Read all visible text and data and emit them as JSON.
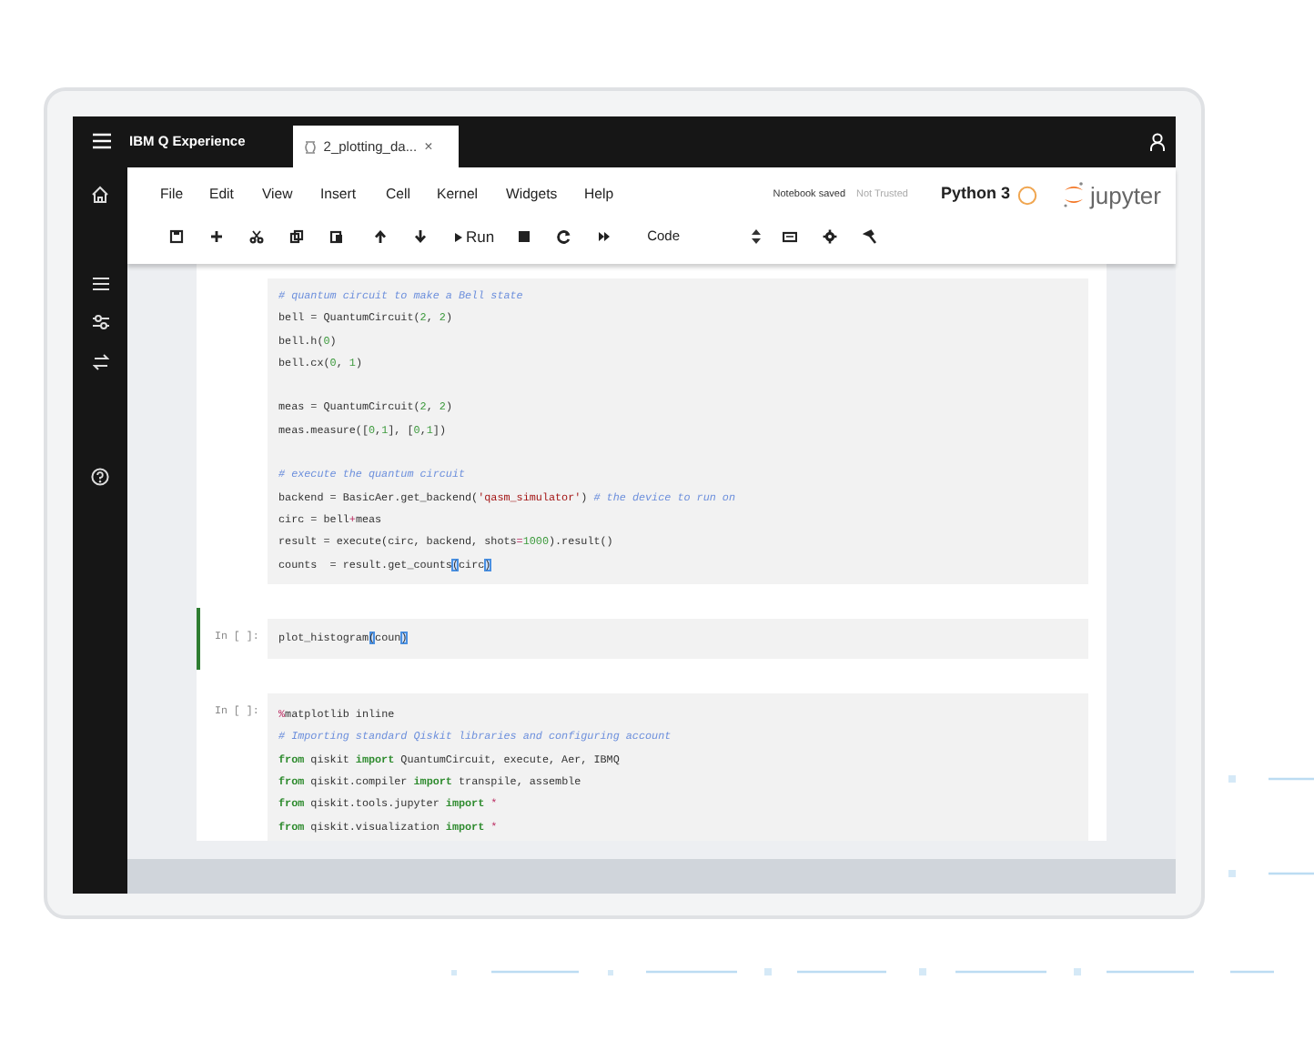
{
  "app_bar": {
    "title": "IBM Q Experience"
  },
  "tabs": [
    {
      "label": "2_plotting_da...",
      "close": "×",
      "selected": true
    }
  ],
  "menu": [
    "File",
    "Edit",
    "View",
    "Insert",
    "Cell",
    "Kernel",
    "Widgets",
    "Help"
  ],
  "status": {
    "save_state": "Notebook saved",
    "trust": "Not Trusted",
    "kernel": "Python 3",
    "kernel_busy": false,
    "logo": "jupyter"
  },
  "toolbar": {
    "run_label": "Run",
    "cell_type": "Code"
  },
  "cells": [
    {
      "selected": false,
      "lines": [
        {
          "kind": "code",
          "tokens": [
            {
              "kind": "comment",
              "text": "# quantum circuit to make a Bell state"
            }
          ]
        },
        {
          "kind": "code",
          "tokens": [
            {
              "kind": "plain",
              "text": "bell = QuantumCircuit("
            },
            {
              "kind": "num",
              "text": "2"
            },
            {
              "kind": "plain",
              "text": ", "
            },
            {
              "kind": "num",
              "text": "2"
            },
            {
              "kind": "plain",
              "text": ")"
            }
          ]
        },
        {
          "kind": "code",
          "tokens": [
            {
              "kind": "plain",
              "text": "bell.h("
            },
            {
              "kind": "num",
              "text": "0"
            },
            {
              "kind": "plain",
              "text": ")"
            }
          ]
        },
        {
          "kind": "code",
          "tokens": [
            {
              "kind": "plain",
              "text": "bell.cx("
            },
            {
              "kind": "num",
              "text": "0"
            },
            {
              "kind": "plain",
              "text": ", "
            },
            {
              "kind": "num",
              "text": "1"
            },
            {
              "kind": "plain",
              "text": ")"
            }
          ]
        },
        {
          "kind": "blank"
        },
        {
          "kind": "code",
          "tokens": [
            {
              "kind": "plain",
              "text": "meas = QuantumCircuit("
            },
            {
              "kind": "num",
              "text": "2"
            },
            {
              "kind": "plain",
              "text": ", "
            },
            {
              "kind": "num",
              "text": "2"
            },
            {
              "kind": "plain",
              "text": ")"
            }
          ]
        },
        {
          "kind": "code",
          "tokens": [
            {
              "kind": "plain",
              "text": "meas.measure(["
            },
            {
              "kind": "num",
              "text": "0"
            },
            {
              "kind": "plain",
              "text": ","
            },
            {
              "kind": "num",
              "text": "1"
            },
            {
              "kind": "plain",
              "text": "], ["
            },
            {
              "kind": "num",
              "text": "0"
            },
            {
              "kind": "plain",
              "text": ","
            },
            {
              "kind": "num",
              "text": "1"
            },
            {
              "kind": "plain",
              "text": "])"
            }
          ]
        },
        {
          "kind": "blank"
        },
        {
          "kind": "code",
          "tokens": [
            {
              "kind": "comment",
              "text": "# execute the quantum circuit"
            }
          ]
        },
        {
          "kind": "code",
          "tokens": [
            {
              "kind": "plain",
              "text": "backend = BasicAer.get_backend("
            },
            {
              "kind": "str",
              "text": "'qasm_simulator'"
            },
            {
              "kind": "plain",
              "text": ") "
            },
            {
              "kind": "comment",
              "text": "# the device to run on"
            }
          ]
        },
        {
          "kind": "code",
          "tokens": [
            {
              "kind": "plain",
              "text": "circ = bell"
            },
            {
              "kind": "op",
              "text": "+"
            },
            {
              "kind": "plain",
              "text": "meas"
            }
          ]
        },
        {
          "kind": "code",
          "tokens": [
            {
              "kind": "plain",
              "text": "result = execute(circ, backend, shots"
            },
            {
              "kind": "op",
              "text": "="
            },
            {
              "kind": "num",
              "text": "1000"
            },
            {
              "kind": "plain",
              "text": ").result()"
            }
          ]
        },
        {
          "kind": "code",
          "tokens": [
            {
              "kind": "plain",
              "text": "counts  = result.get_counts"
            },
            {
              "kind": "bracket",
              "text": "("
            },
            {
              "kind": "plain",
              "text": "circ"
            },
            {
              "kind": "bracket",
              "text": ")"
            }
          ]
        }
      ]
    },
    {
      "prompt": "In [ ]:",
      "selected": true,
      "lines": [
        {
          "kind": "code",
          "tokens": [
            {
              "kind": "plain",
              "text": "plot_histogram"
            },
            {
              "kind": "bracket",
              "text": "("
            },
            {
              "kind": "plain",
              "text": "coun"
            },
            {
              "kind": "bracket",
              "text": ")"
            }
          ]
        }
      ]
    },
    {
      "prompt": "In [ ]:",
      "selected": false,
      "lines": [
        {
          "kind": "code",
          "tokens": [
            {
              "kind": "op",
              "text": "%"
            },
            {
              "kind": "plain",
              "text": "matplotlib inline"
            }
          ]
        },
        {
          "kind": "code",
          "tokens": [
            {
              "kind": "comment",
              "text": "# Importing standard Qiskit libraries and configuring account"
            }
          ]
        },
        {
          "kind": "code",
          "tokens": [
            {
              "kind": "kw",
              "text": "from"
            },
            {
              "kind": "plain",
              "text": " qiskit "
            },
            {
              "kind": "kw",
              "text": "import"
            },
            {
              "kind": "plain",
              "text": " QuantumCircuit, execute, Aer, IBMQ"
            }
          ]
        },
        {
          "kind": "code",
          "tokens": [
            {
              "kind": "kw",
              "text": "from"
            },
            {
              "kind": "plain",
              "text": " qiskit.compiler "
            },
            {
              "kind": "kw",
              "text": "import"
            },
            {
              "kind": "plain",
              "text": " transpile, assemble"
            }
          ]
        },
        {
          "kind": "code",
          "tokens": [
            {
              "kind": "kw",
              "text": "from"
            },
            {
              "kind": "plain",
              "text": " qiskit.tools.jupyter "
            },
            {
              "kind": "kw",
              "text": "import"
            },
            {
              "kind": "op",
              "text": " *"
            }
          ]
        },
        {
          "kind": "code",
          "tokens": [
            {
              "kind": "kw",
              "text": "from"
            },
            {
              "kind": "plain",
              "text": " qiskit.visualization "
            },
            {
              "kind": "kw",
              "text": "import"
            },
            {
              "kind": "op",
              "text": " *"
            }
          ]
        }
      ]
    }
  ]
}
